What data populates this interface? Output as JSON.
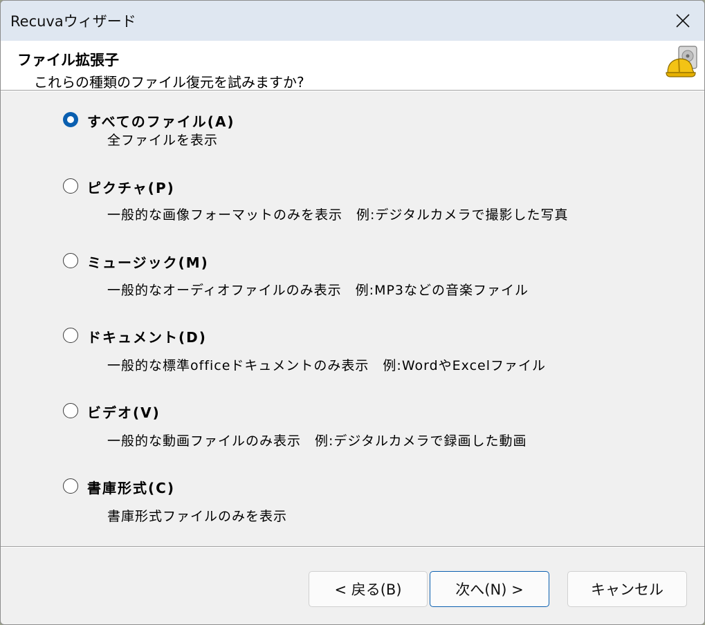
{
  "window": {
    "title": "Recuvaウィザード",
    "close_symbol": "✕"
  },
  "header": {
    "title": "ファイル拡張子",
    "subtitle": "これらの種類のファイル復元を試みますか?",
    "icon": "recuva-drive-helmet-icon"
  },
  "options": [
    {
      "label": "すべてのファイル(A)",
      "description": "全ファイルを表示",
      "checked": true
    },
    {
      "label": "ピクチャ(P)",
      "description": "一般的な画像フォーマットのみを表示　例:デジタルカメラで撮影した写真",
      "checked": false
    },
    {
      "label": "ミュージック(M)",
      "description": "一般的なオーディオファイルのみ表示　例:MP3などの音楽ファイル",
      "checked": false
    },
    {
      "label": "ドキュメント(D)",
      "description": "一般的な標準officeドキュメントのみ表示　例:WordやExcelファイル",
      "checked": false
    },
    {
      "label": "ビデオ(V)",
      "description": "一般的な動画ファイルのみ表示　例:デジタルカメラで録画した動画",
      "checked": false
    },
    {
      "label": "書庫形式(C)",
      "description": "書庫形式ファイルのみを表示",
      "checked": false
    }
  ],
  "buttons": {
    "back": "< 戻る(B)",
    "next": "次へ(N) >",
    "cancel": "キャンセル"
  },
  "colors": {
    "accent": "#0a5fb0",
    "titlebar": "#dfe7f1",
    "body": "#f0f0f0"
  }
}
